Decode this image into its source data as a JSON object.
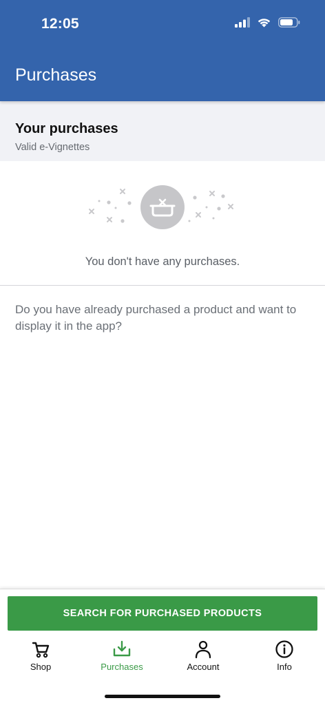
{
  "status_bar": {
    "time": "12:05"
  },
  "header": {
    "title": "Purchases"
  },
  "section": {
    "title": "Your purchases",
    "subtitle": "Valid e-Vignettes"
  },
  "empty_state": {
    "message": "You don't have any purchases."
  },
  "hint": {
    "text": "Do you have already purchased a product and want to display it in the app?"
  },
  "action": {
    "label": "SEARCH FOR PURCHASED PRODUCTS"
  },
  "tabs": [
    {
      "label": "Shop",
      "icon": "cart-icon",
      "active": false
    },
    {
      "label": "Purchases",
      "icon": "download-tray-icon",
      "active": true
    },
    {
      "label": "Account",
      "icon": "person-icon",
      "active": false
    },
    {
      "label": "Info",
      "icon": "info-icon",
      "active": false
    }
  ],
  "colors": {
    "header": "#3464ac",
    "accent_green": "#3a9a47",
    "section_bg": "#f1f2f6",
    "muted_text": "#666a70"
  }
}
